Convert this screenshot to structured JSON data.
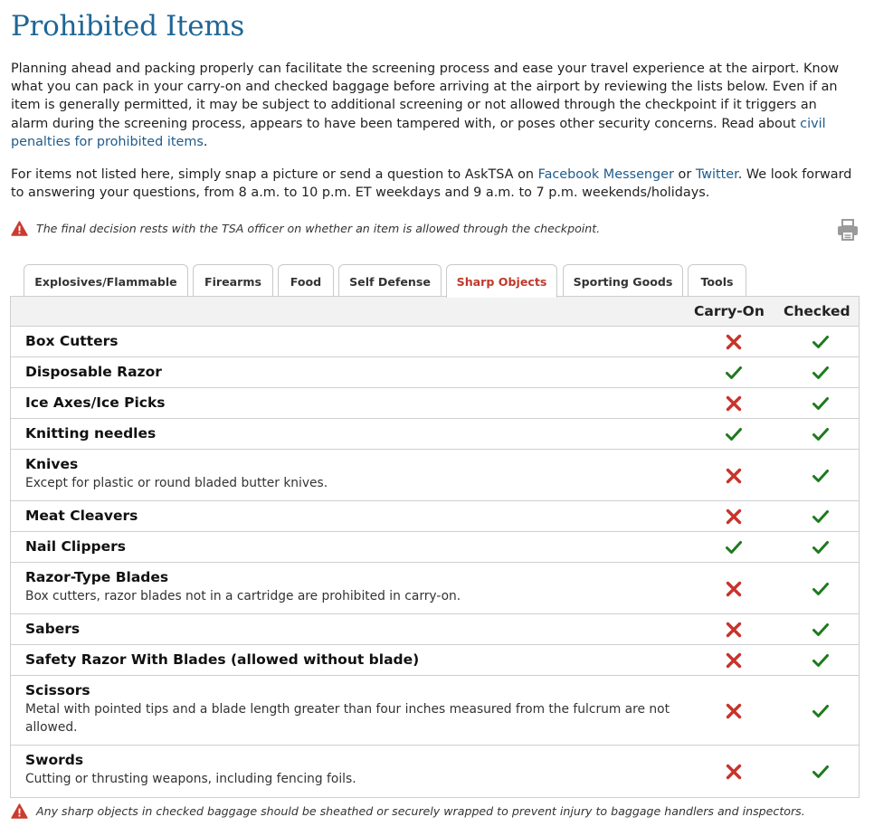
{
  "title": "Prohibited Items",
  "intro": {
    "text": "Planning ahead and packing properly can facilitate the screening process and ease your travel experience at the airport. Know what you can pack in your carry-on and checked baggage before arriving at the airport by reviewing the lists below. Even if an item is generally permitted, it may be subject to additional screening or not allowed through the checkpoint if it triggers an alarm during the screening process, appears to have been tampered with, or poses other security concerns. Read about ",
    "link": "civil penalties for prohibited items",
    "end": "."
  },
  "asktsa": {
    "before": "For items not listed here, simply snap a picture or send a question to AskTSA on ",
    "link1": "Facebook Messenger",
    "middle": " or ",
    "link2": "Twitter",
    "after": ". We look forward to answering your questions, from 8 a.m. to 10 p.m. ET weekdays and 9 a.m. to 7 p.m. weekends/holidays."
  },
  "notice_top": "The final decision rests with the TSA officer on whether an item is allowed through the checkpoint.",
  "notice_bottom": "Any sharp objects in checked baggage should be sheathed or securely wrapped to prevent injury to baggage handlers and inspectors.",
  "icons": {
    "warning": "warning-triangle-icon",
    "print": "printer-icon",
    "yes": "check-icon",
    "no": "x-icon"
  },
  "colors": {
    "title": "#1f6696",
    "link": "#1f5b8c",
    "active_tab": "#c0392b",
    "yes": "#1e7a1e",
    "no": "#c8332b",
    "warning": "#cc3b2f"
  },
  "tabs": [
    {
      "label": "Explosives/Flammable",
      "active": false
    },
    {
      "label": "Firearms",
      "active": false
    },
    {
      "label": "Food",
      "active": false
    },
    {
      "label": "Self Defense",
      "active": false
    },
    {
      "label": "Sharp Objects",
      "active": true
    },
    {
      "label": "Sporting Goods",
      "active": false
    },
    {
      "label": "Tools",
      "active": false
    }
  ],
  "table": {
    "headers": {
      "carry_on": "Carry-On",
      "checked": "Checked"
    },
    "rows": [
      {
        "name": "Box Cutters",
        "note": "",
        "carry_on": "no",
        "checked": "yes"
      },
      {
        "name": "Disposable Razor",
        "note": "",
        "carry_on": "yes",
        "checked": "yes"
      },
      {
        "name": "Ice Axes/Ice Picks",
        "note": "",
        "carry_on": "no",
        "checked": "yes"
      },
      {
        "name": "Knitting needles",
        "note": "",
        "carry_on": "yes",
        "checked": "yes"
      },
      {
        "name": "Knives",
        "note": "Except for plastic or round bladed butter knives.",
        "carry_on": "no",
        "checked": "yes"
      },
      {
        "name": "Meat Cleavers",
        "note": "",
        "carry_on": "no",
        "checked": "yes"
      },
      {
        "name": "Nail Clippers",
        "note": "",
        "carry_on": "yes",
        "checked": "yes"
      },
      {
        "name": "Razor-Type Blades",
        "note": "Box cutters, razor blades not in a cartridge are prohibited in carry-on.",
        "carry_on": "no",
        "checked": "yes"
      },
      {
        "name": "Sabers",
        "note": "",
        "carry_on": "no",
        "checked": "yes"
      },
      {
        "name": "Safety Razor With Blades (allowed without blade)",
        "note": "",
        "carry_on": "no",
        "checked": "yes"
      },
      {
        "name": "Scissors",
        "note": "Metal with pointed tips and a blade length greater than four inches measured from the fulcrum are not allowed.",
        "carry_on": "no",
        "checked": "yes"
      },
      {
        "name": "Swords",
        "note": "Cutting or thrusting weapons, including fencing foils.",
        "carry_on": "no",
        "checked": "yes"
      }
    ]
  }
}
